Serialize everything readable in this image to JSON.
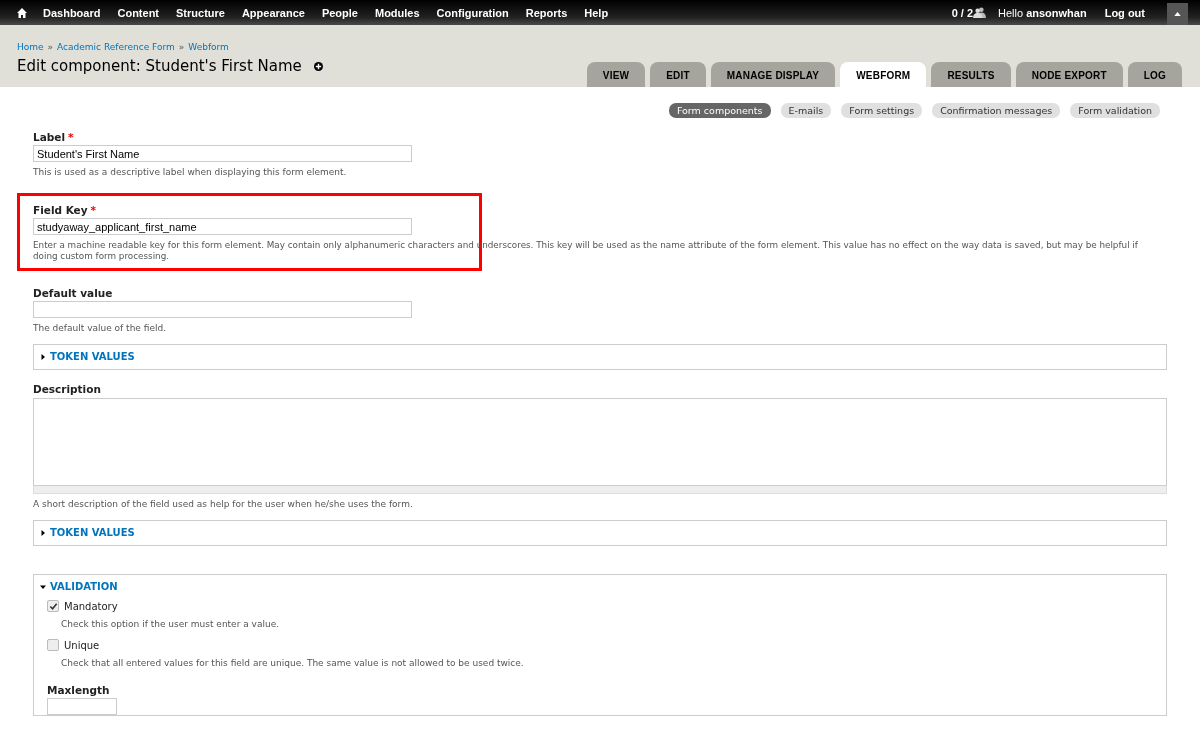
{
  "toolbar": {
    "menu": [
      "Dashboard",
      "Content",
      "Structure",
      "Appearance",
      "People",
      "Modules",
      "Configuration",
      "Reports",
      "Help"
    ],
    "users_count": "0 / 2",
    "greeting": "Hello **ansonwhan**",
    "logout": "Log out"
  },
  "breadcrumb": [
    {
      "kind": "link",
      "text": "Home"
    },
    {
      "kind": "separator",
      "text": "»"
    },
    {
      "kind": "link",
      "text": "Academic Reference Form"
    },
    {
      "kind": "separator",
      "text": "»"
    },
    {
      "kind": "link",
      "text": "Webform"
    }
  ],
  "page_title": "Edit component: Student's First Name",
  "tabs": [
    {
      "label": "VIEW",
      "selected": false
    },
    {
      "label": "EDIT",
      "selected": false
    },
    {
      "label": "MANAGE DISPLAY",
      "selected": false
    },
    {
      "label": "WEBFORM",
      "selected": true
    },
    {
      "label": "RESULTS",
      "selected": false
    },
    {
      "label": "NODE EXPORT",
      "selected": false
    },
    {
      "label": "LOG",
      "selected": false
    }
  ],
  "secondary_tabs": [
    {
      "label": "Form components",
      "selected": true
    },
    {
      "label": "E-mails",
      "selected": false
    },
    {
      "label": "Form settings",
      "selected": false
    },
    {
      "label": "Confirmation messages",
      "selected": false
    },
    {
      "label": "Form validation",
      "selected": false
    }
  ],
  "form": [
    {
      "kind": "text",
      "label": "Label",
      "required_mark": "*",
      "value": "Student's First Name",
      "help": "This is used as a descriptive label when displaying this form element."
    },
    {
      "kind": "text",
      "label": "Field Key",
      "required_mark": "*",
      "value": "studyaway_applicant_first_name",
      "help": "Enter a machine readable key for this form element. May contain only alphanumeric characters and underscores. This key will be used as the name attribute of the form element. This value has no effect on the way data is saved, but may be helpful if doing custom form processing.",
      "highlighted": true
    },
    {
      "kind": "text",
      "label": "Default value",
      "help": "The default value of the field."
    },
    {
      "kind": "fieldset",
      "title": "TOKEN VALUES",
      "expanded": false
    },
    {
      "kind": "textarea",
      "label": "Description",
      "help": "A short description of the field used as help for the user when he/she uses the form."
    },
    {
      "kind": "fieldset",
      "title": "TOKEN VALUES",
      "expanded": false
    },
    {
      "kind": "fieldset",
      "title": "VALIDATION",
      "expanded": true,
      "children": [
        {
          "kind": "checkbox",
          "label": "Mandatory",
          "checked": true,
          "help": "Check this option if the user must enter a value."
        },
        {
          "kind": "checkbox",
          "label": "Unique",
          "checked": false,
          "help": "Check that all entered values for this field are unique. The same value is not allowed to be used twice."
        },
        {
          "kind": "text",
          "label": "Maxlength"
        }
      ]
    }
  ]
}
